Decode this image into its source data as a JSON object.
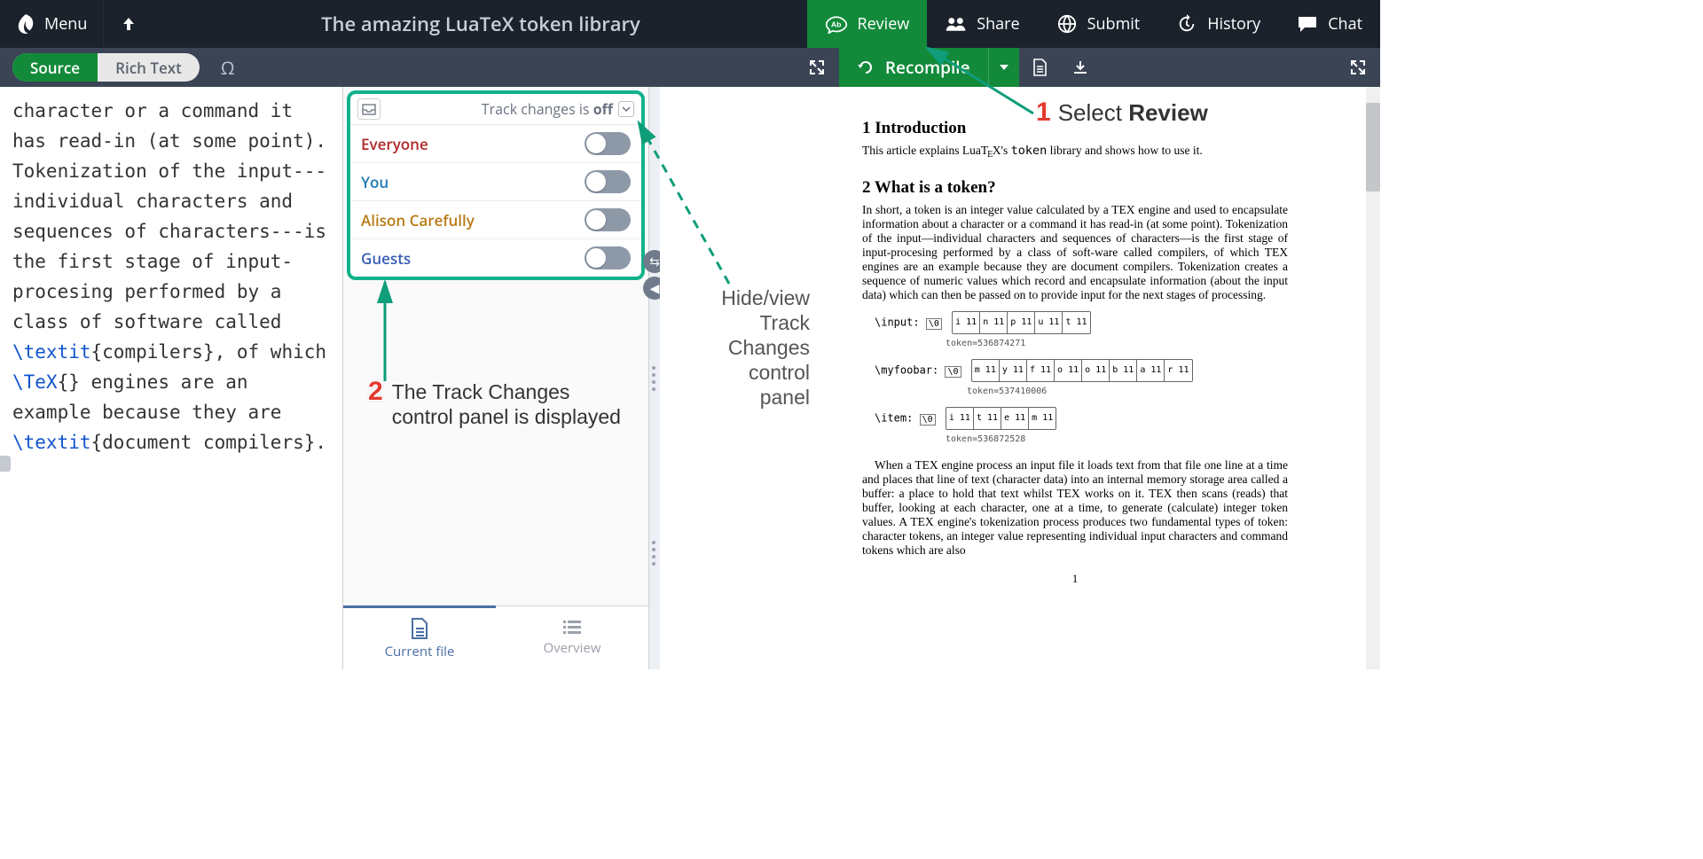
{
  "topnav": {
    "menu": "Menu",
    "title": "The amazing LuaTeX token library",
    "review": "Review",
    "share": "Share",
    "submit": "Submit",
    "history": "History",
    "chat": "Chat"
  },
  "subbar": {
    "source": "Source",
    "rich": "Rich Text",
    "omega": "Ω",
    "recompile": "Recompile"
  },
  "editor": {
    "text_pre1": "character or a command it has read-in (at some point). Tokenization of the input---individual characters and sequences of characters---is the first stage of input-procesing performed by a class of software called ",
    "cmd1": "\\textit",
    "text_mid1": "{compilers}, of which ",
    "cmd2": "\\TeX",
    "text_mid2": "{} engines are an example because they are ",
    "cmd3": "\\textit",
    "text_post": "{document compilers}."
  },
  "track_changes": {
    "status_pre": "Track changes is ",
    "status_state": "off",
    "rows": {
      "everyone": "Everyone",
      "you": "You",
      "alison": "Alison Carefully",
      "guests": "Guests"
    }
  },
  "review_tabs": {
    "current": "Current file",
    "overview": "Overview"
  },
  "pdf": {
    "h1": "1   Introduction",
    "p1_a": "This article explains LuaT",
    "p1_b": "X's ",
    "p1_c": "token",
    "p1_d": " library and shows how to use it.",
    "h2": "2   What is a token?",
    "p2": "In short, a token is an integer value calculated by a TEX engine and used to encapsulate information about a character or a command it has read-in (at some point). Tokenization of the input—individual characters and sequences of characters—is the first stage of input-procesing performed by a class of soft-ware called compilers, of which TEX engines are an example because they are document compilers. Tokenization creates a sequence of numeric values which record and encapsulate information (about the input data) which can then be passed on to provide input for the next stages of processing.",
    "tok_input": "\\input:",
    "tok_input_val": "token=536874271",
    "tok_myfoo": "\\myfoobar:",
    "tok_myfoo_val": "token=537410006",
    "tok_item": "\\item:",
    "tok_item_val": "token=536872528",
    "p3": "When a TEX engine process an input file it loads text from that file one line at a time and places that line of text (character data) into an internal memory storage area called a buffer: a place to hold that text whilst TEX works on it. TEX then scans (reads) that buffer, looking at each character, one at a time, to generate (calculate) integer token values. A TEX engine's tokenization process produces two fundamental types of token: character tokens, an integer value representing individual input characters and command tokens which are also",
    "page": "1"
  },
  "annotations": {
    "a1_pre": "Select ",
    "a1_b": "Review",
    "a2": "The Track Changes control panel is displayed",
    "a3": "Hide/view Track Changes control panel"
  }
}
